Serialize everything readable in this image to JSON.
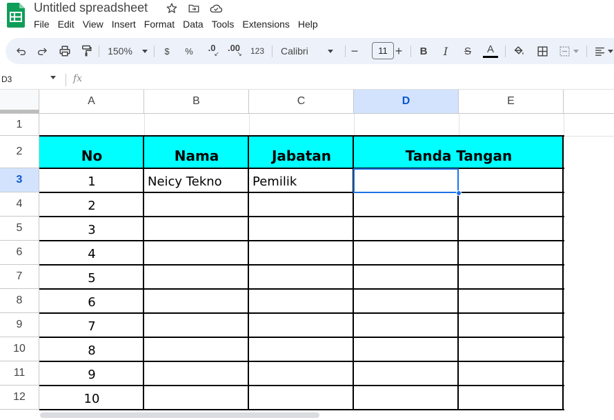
{
  "app": {
    "title": "Untitled spreadsheet",
    "brand_color": "#0f9d58"
  },
  "title_icons": [
    "star-icon",
    "move-to-folder-icon",
    "cloud-saved-icon"
  ],
  "menu": [
    "File",
    "Edit",
    "View",
    "Insert",
    "Format",
    "Data",
    "Tools",
    "Extensions",
    "Help"
  ],
  "toolbar": {
    "zoom": "150%",
    "currency": "$",
    "percent": "%",
    "decrease_decimal": ".0",
    "increase_decimal": ".00",
    "number_format": "123",
    "font": "Calibri",
    "minus": "−",
    "font_size": "11",
    "plus": "+",
    "bold": "B",
    "italic": "I",
    "strikethrough": "S",
    "text_color": "A",
    "text_color_value": "#000000"
  },
  "formula_bar": {
    "name_box": "D3",
    "fx": "fx"
  },
  "columns": [
    "A",
    "B",
    "C",
    "D",
    "E",
    ""
  ],
  "selected_column": "D",
  "rows": [
    "1",
    "2",
    "3",
    "4",
    "5",
    "6",
    "7",
    "8",
    "9",
    "10",
    "11",
    "12"
  ],
  "selected_row": "3",
  "table": {
    "header_fill": "#00ffff",
    "headers": {
      "no": "No",
      "nama": "Nama",
      "jabatan": "Jabatan",
      "tanda_tangan": "Tanda Tangan"
    },
    "numbers": [
      "1",
      "2",
      "3",
      "4",
      "5",
      "6",
      "7",
      "8",
      "9",
      "10"
    ],
    "row1": {
      "nama": "Neicy Tekno",
      "jabatan": "Pemilik"
    }
  },
  "selection": {
    "cell": "D3",
    "color": "#1a73e8"
  }
}
